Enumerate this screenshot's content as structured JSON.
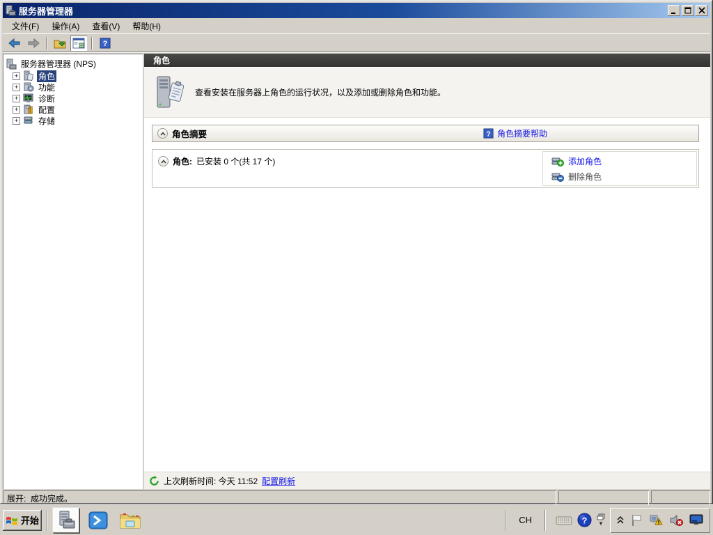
{
  "window": {
    "title": "服务器管理器"
  },
  "menu": {
    "items": [
      {
        "label": "文件(F)"
      },
      {
        "label": "操作(A)"
      },
      {
        "label": "查看(V)"
      },
      {
        "label": "帮助(H)"
      }
    ]
  },
  "tree": {
    "root": "服务器管理器  (NPS)",
    "items": [
      {
        "label": "角色"
      },
      {
        "label": "功能"
      },
      {
        "label": "诊断"
      },
      {
        "label": "配置"
      },
      {
        "label": "存储"
      }
    ]
  },
  "main": {
    "page_title": "角色",
    "description": "查看安装在服务器上角色的运行状况，以及添加或删除角色和功能。",
    "summary_title": "角色摘要",
    "summary_help": "角色摘要帮助",
    "roles_label": "角色:",
    "roles_status": "已安装 0 个(共 17 个)",
    "add_role": "添加角色",
    "remove_role": "删除角色",
    "refresh_label": "上次刷新时间: 今天 11:52",
    "refresh_link": "配置刷新"
  },
  "statusbar": {
    "text": "展开:  成功完成。"
  },
  "taskbar": {
    "start_label": "开始",
    "language": "CH"
  },
  "icons": {
    "help_glyph": "?"
  },
  "colors": {
    "titlebar_left": "#0a246a",
    "titlebar_right": "#a6caf0",
    "chrome": "#d4d0c8",
    "link_blue": "#1414e6",
    "selection_blue": "#29437c",
    "header_dark": "#3a3a38"
  }
}
